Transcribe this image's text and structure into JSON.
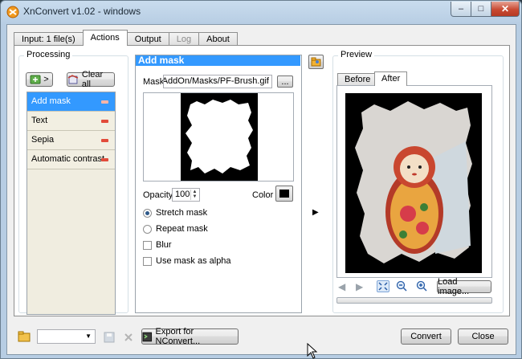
{
  "window": {
    "title": "XnConvert v1.02 - windows",
    "minimize_glyph": "–",
    "maximize_glyph": "□",
    "close_glyph": "✕"
  },
  "tabs": [
    {
      "label": "Input: 1 file(s)",
      "state": "normal"
    },
    {
      "label": "Actions",
      "state": "active"
    },
    {
      "label": "Output",
      "state": "normal"
    },
    {
      "label": "Log",
      "state": "disabled"
    },
    {
      "label": "About",
      "state": "normal"
    }
  ],
  "processing": {
    "group_label": "Processing",
    "add_button_arrow": ">",
    "clear_all_label": "Clear all",
    "actions": [
      {
        "label": "Add mask",
        "selected": true
      },
      {
        "label": "Text",
        "selected": false
      },
      {
        "label": "Sepia",
        "selected": false
      },
      {
        "label": "Automatic contrast",
        "selected": false
      }
    ]
  },
  "action_panel": {
    "header": "Add mask",
    "mask_label": "Mask",
    "mask_value": "vert/AddOn/Masks/PF-Brush.gif",
    "browse_label": "...",
    "opacity_label": "Opacity",
    "opacity_value": "100",
    "color_label": "Color",
    "color_value": "#000000",
    "options": [
      {
        "label": "Stretch mask",
        "type": "radio",
        "checked": true
      },
      {
        "label": "Repeat mask",
        "type": "radio",
        "checked": false
      },
      {
        "label": "Blur",
        "type": "checkbox",
        "checked": false
      },
      {
        "label": "Use mask as alpha",
        "type": "checkbox",
        "checked": false
      }
    ],
    "apply_arrow": "▶"
  },
  "preview": {
    "group_label": "Preview",
    "tab_before": "Before",
    "tab_after": "After",
    "active_tab": "After",
    "load_image_label": "Load image..."
  },
  "bottom": {
    "preset_value": "",
    "export_label": "Export for NConvert...",
    "convert_label": "Convert",
    "close_label": "Close"
  }
}
